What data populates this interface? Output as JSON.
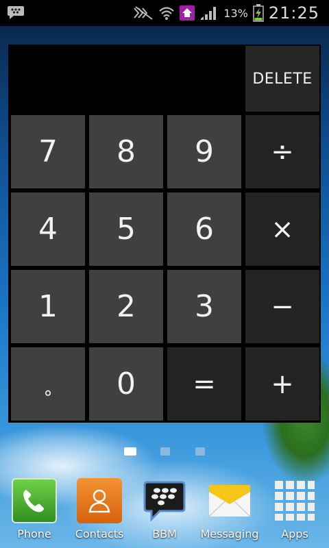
{
  "status_bar": {
    "battery_percent": "13%",
    "clock": "21:25",
    "icons": [
      "bbm-notification-icon",
      "mute-icon",
      "wifi-icon",
      "home-icon",
      "signal-icon",
      "battery-charging-icon"
    ]
  },
  "calculator": {
    "display_value": "",
    "delete_label": "DELETE",
    "keys": {
      "seven": "7",
      "eight": "8",
      "nine": "9",
      "divide": "÷",
      "four": "4",
      "five": "5",
      "six": "6",
      "multiply": "×",
      "one": "1",
      "two": "2",
      "three": "3",
      "minus": "−",
      "dot": "∘",
      "zero": "0",
      "equals": "=",
      "plus": "+"
    }
  },
  "page_indicator": {
    "pages": 3,
    "active": 1
  },
  "dock": {
    "items": [
      {
        "label": "Phone",
        "icon": "phone-icon"
      },
      {
        "label": "Contacts",
        "icon": "contacts-icon"
      },
      {
        "label": "BBM",
        "icon": "bbm-icon"
      },
      {
        "label": "Messaging",
        "icon": "messaging-icon"
      },
      {
        "label": "Apps",
        "icon": "apps-grid-icon"
      }
    ]
  },
  "colors": {
    "key_number": "#404040",
    "key_operator": "#232323",
    "phone_green": "#4caf3a",
    "contacts_orange": "#e8741c",
    "messaging_yellow": "#f5c518"
  }
}
